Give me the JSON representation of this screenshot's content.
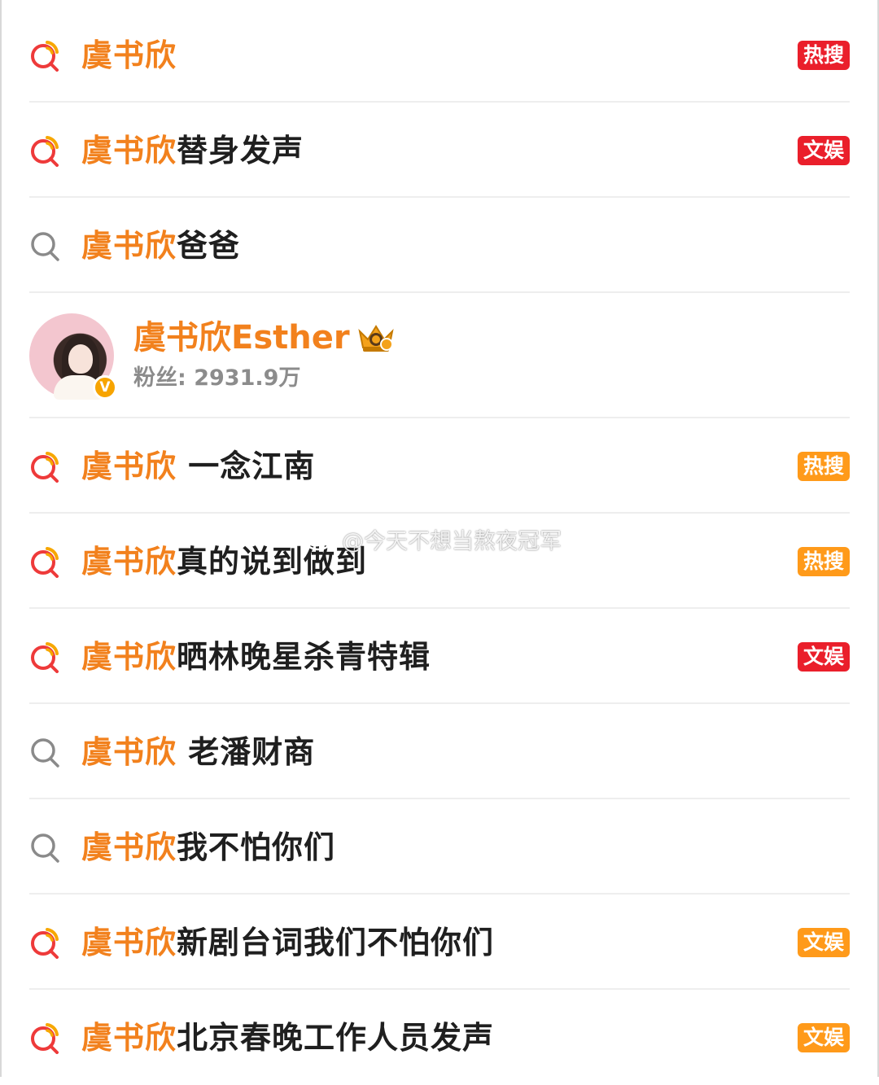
{
  "suggestions": [
    {
      "hl": "虞书欣",
      "rest": "",
      "icon": "hot-search-icon",
      "badge": "热搜",
      "badge_color": "#ea1f2b"
    },
    {
      "hl": "虞书欣",
      "rest": "替身发声",
      "icon": "hot-search-icon",
      "badge": "文娱",
      "badge_color": "#ea1f2b"
    },
    {
      "hl": "虞书欣",
      "rest": "爸爸",
      "icon": "search-icon",
      "badge": "",
      "badge_color": ""
    },
    {
      "hl": "虞书欣",
      "rest": " 一念江南",
      "icon": "hot-search-icon",
      "badge": "热搜",
      "badge_color": "#ff9a1a"
    },
    {
      "hl": "虞书欣",
      "rest": "真的说到做到",
      "icon": "hot-search-icon",
      "badge": "热搜",
      "badge_color": "#ff9a1a"
    },
    {
      "hl": "虞书欣",
      "rest": "晒林晚星杀青特辑",
      "icon": "hot-search-icon",
      "badge": "文娱",
      "badge_color": "#ea1f2b"
    },
    {
      "hl": "虞书欣",
      "rest": " 老潘财商",
      "icon": "search-icon",
      "badge": "",
      "badge_color": ""
    },
    {
      "hl": "虞书欣",
      "rest": "我不怕你们",
      "icon": "search-icon",
      "badge": "",
      "badge_color": ""
    },
    {
      "hl": "虞书欣",
      "rest": "新剧台词我们不怕你们",
      "icon": "hot-search-icon",
      "badge": "文娱",
      "badge_color": "#ff9a1a"
    },
    {
      "hl": "虞书欣",
      "rest": "北京春晚工作人员发声",
      "icon": "hot-search-icon",
      "badge": "文娱",
      "badge_color": "#ff9a1a"
    }
  ],
  "user": {
    "name": "虞书欣Esther",
    "fans_label": "粉丝: ",
    "fans_count": "2931.9万",
    "verified_badge": "V",
    "avatar_icon": "avatar",
    "member_icon": "crown-icon"
  },
  "watermark": {
    "text": "@今天不想当熬夜冠军",
    "logo_icon": "weibo-logo-icon"
  },
  "colors": {
    "highlight": "#f2811d",
    "badge_red": "#ea1f2b",
    "badge_orange": "#ff9a1a"
  }
}
